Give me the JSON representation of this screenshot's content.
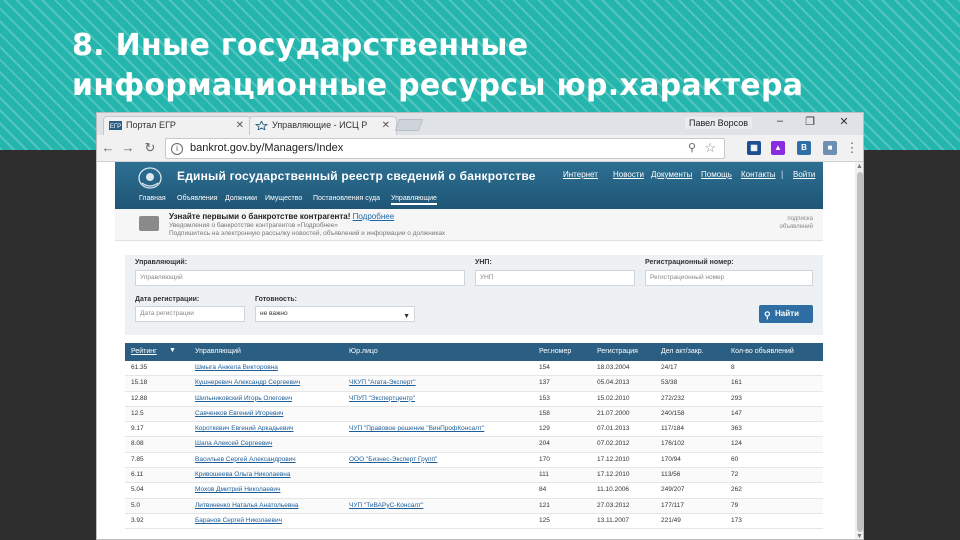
{
  "slide": {
    "title_line1": "8. Иные государственные",
    "title_line2": "информационные ресурсы юр.характера",
    "colors": {
      "teal": "#24b5ad",
      "dark": "#2e2e2e"
    }
  },
  "browser": {
    "tabs": [
      {
        "label": "Портал ЕГР",
        "favicon": "egr-logo-icon"
      },
      {
        "label": "Управляющие - ИСЦ Р",
        "favicon": "star-icon"
      }
    ],
    "user": "Павел Ворсов",
    "url": "bankrot.gov.by/Managers/Index",
    "ext_labels": [
      "В"
    ]
  },
  "site": {
    "title": "Единый государственный реестр сведений о банкротстве",
    "top_links": [
      "Интернет",
      "Новости",
      "Документы",
      "Помощь",
      "Контакты",
      "Войти"
    ],
    "nav": [
      "Главная",
      "Объявления",
      "Должники",
      "Имущество",
      "Постановления суда",
      "Управляющие"
    ],
    "active_nav": "Управляющие",
    "subscribe": {
      "headline": "Узнайте первыми о банкротстве контрагента!",
      "link": "Подробнее",
      "line2": "Уведомления о банкротстве контрагентов «Подробнее»",
      "line3": "Подпишитесь на электронную рассылку новостей, объявлений и информации о должниках",
      "right_line1": "подписка",
      "right_line2": "объявлений"
    }
  },
  "filters": {
    "manager_label": "Управляющий:",
    "manager_placeholder": "Управляющий",
    "unp_label": "УНП:",
    "unp_placeholder": "УНП",
    "regnum_label": "Регистрационный номер:",
    "regnum_placeholder": "Регистрационный номер",
    "regdate_label": "Дата регистрации:",
    "regdate_placeholder": "Дата регистрации",
    "ready_label": "Готовность:",
    "ready_value": "не важно",
    "find_button": "Найти"
  },
  "table": {
    "headers": [
      "Рейтинг",
      "Управляющий",
      "Юр.лицо",
      "Рег.номер",
      "Регистрация",
      "Дел акт/закр.",
      "Кол-во объявлений"
    ],
    "rows": [
      [
        "61.35",
        "Шмыга Анжела Викторовна",
        "",
        "154",
        "18.03.2004",
        "24/17",
        "8"
      ],
      [
        "15.18",
        "Кушнеревич Александр Сергеевич",
        "ЧКУП \"Агата-Эксперт\"",
        "137",
        "05.04.2013",
        "53/38",
        "161"
      ],
      [
        "12.88",
        "Шильниковский Игорь Олегович",
        "ЧПУП \"Экспертцентр\"",
        "153",
        "15.02.2010",
        "272/232",
        "293"
      ],
      [
        "12.5",
        "Савченков Евгений Игоревич",
        "",
        "158",
        "21.07.2000",
        "240/158",
        "147"
      ],
      [
        "9.17",
        "Короткевич Евгений Аркадьевич",
        "ЧУП \"Правовое решение \"ВинПрофКонсалт\"",
        "129",
        "07.01.2013",
        "117/184",
        "363"
      ],
      [
        "8.08",
        "Шапа Алексей Сергеевич",
        "",
        "204",
        "07.02.2012",
        "176/102",
        "124"
      ],
      [
        "7.85",
        "Васильев Сергей Александрович",
        "ООО \"Бизнес-Эксперт Групп\"",
        "170",
        "17.12.2010",
        "170/94",
        "60"
      ],
      [
        "6.11",
        "Кривошеева Ольга Николаевна",
        "",
        "111",
        "17.12.2010",
        "113/56",
        "72"
      ],
      [
        "5.04",
        "Мохов Дмитрий Николаевич",
        "",
        "84",
        "11.10.2006",
        "249/207",
        "262"
      ],
      [
        "5.0",
        "Литвиненко Наталья Анатольевна",
        "ЧУП \"ТиВАРуС-Консалт\"",
        "121",
        "27.03.2012",
        "177/117",
        "79"
      ],
      [
        "3.92",
        "Баранов Сергей Николаевич",
        "",
        "125",
        "13.11.2007",
        "221/49",
        "173"
      ]
    ]
  }
}
